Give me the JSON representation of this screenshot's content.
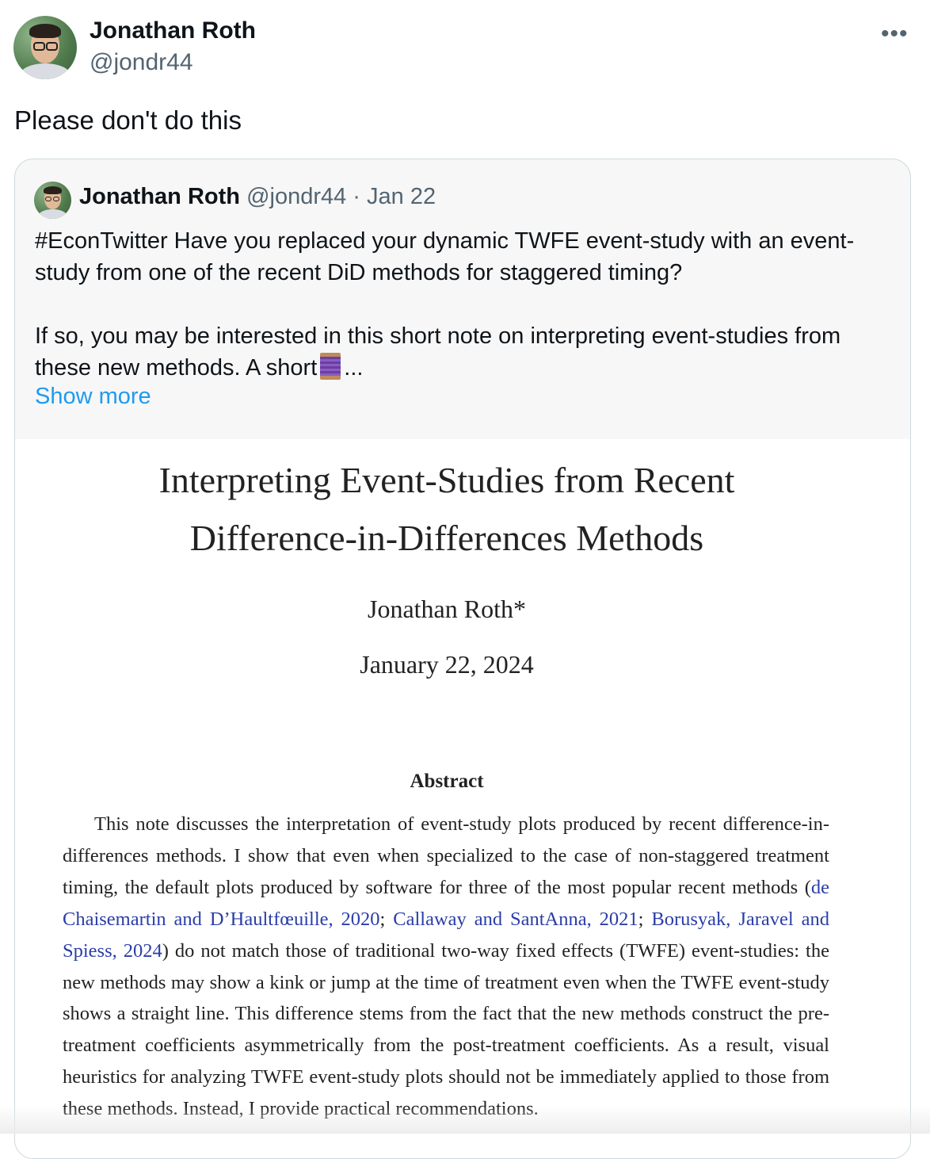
{
  "tweet": {
    "author_name": "Jonathan Roth",
    "author_handle": "@jondr44",
    "more_icon": "more-horizontal-icon",
    "more_glyph": "•••",
    "text": "Please don't do this"
  },
  "quoted_tweet": {
    "author_name": "Jonathan Roth",
    "author_handle": "@jondr44",
    "separator": " · ",
    "date": "Jan 22",
    "paragraph_1": "#EconTwitter Have you replaced your dynamic TWFE event-study with an event-study from one of the recent DiD methods for staggered timing?",
    "paragraph_2_start": "If so, you may be interested in this short note on interpreting event-studies from these new methods. A short",
    "paragraph_2_end": "...",
    "spool_icon": "thread-spool-emoji",
    "show_more": "Show more"
  },
  "paper": {
    "title_line_1": "Interpreting Event-Studies from Recent",
    "title_line_2": "Difference-in-Differences Methods",
    "author": "Jonathan Roth*",
    "date": "January 22, 2024",
    "abstract_heading": "Abstract",
    "abstract_part_1": "This note discusses the interpretation of event-study plots produced by recent difference-in-differences methods. I show that even when specialized to the case of non-staggered treatment timing, the default plots produced by software for three of the most popular recent methods (",
    "citation_1": "de Chaisemartin and D’Haultfœuille, 2020",
    "sep_1": "; ",
    "citation_2": "Callaway and SantAnna, 2021",
    "sep_2": "; ",
    "citation_3": "Borusyak, Jaravel and Spiess, 2024",
    "abstract_part_2": ") do not match those of traditional two-way fixed effects (TWFE) event-studies: the new methods may show a kink or jump at the time of treatment even when the TWFE event-study shows a straight line. This difference stems from the fact that the new methods construct the pre-treatment coefficients asymmetrically from the post-treatment coefficients. As a result, visual heuristics for analyzing TWFE event-study plots should not be immediately applied to those from these methods. Instead, I provide practical recommendations."
  },
  "colors": {
    "link": "#1d9bf0",
    "muted": "#536471",
    "citation": "#2a3ea8"
  }
}
